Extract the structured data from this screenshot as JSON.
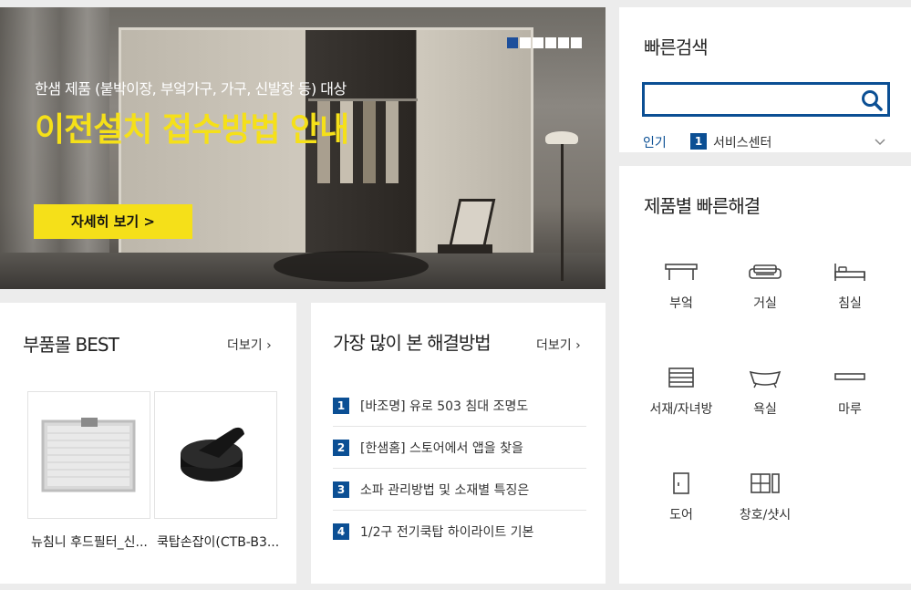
{
  "banner": {
    "subtitle": "한샘 제품 (붙박이장, 부엌가구, 가구, 신발장 등) 대상",
    "headline": "이전설치 접수방법 안내",
    "cta": "자세히 보기  >",
    "slide_count": 6,
    "active_slide": 1
  },
  "parts": {
    "title": "부품몰 BEST",
    "more": "더보기 ›",
    "products": [
      {
        "name": "뉴침니 후드필터_신..."
      },
      {
        "name": "쿡탑손잡이(CTB-B3..."
      }
    ]
  },
  "solutions": {
    "title": "가장 많이 본 해결방법",
    "more": "더보기 ›",
    "items": [
      {
        "num": "1",
        "text": "[바조명] 유로 503 침대 조명도"
      },
      {
        "num": "2",
        "text": "[한샘홈] 스토어에서 앱을 찾을"
      },
      {
        "num": "3",
        "text": "소파 관리방법 및 소재별 특징은"
      },
      {
        "num": "4",
        "text": "1/2구 전기쿡탑 하이라이트 기본"
      }
    ]
  },
  "quick_search": {
    "title": "빠른검색",
    "input_value": "",
    "popular_label": "인기",
    "popular_num": "1",
    "popular_text": "서비스센터"
  },
  "quick_resolve": {
    "title": "제품별 빠른해결",
    "categories": [
      {
        "label": "부엌",
        "icon": "kitchen-table-icon"
      },
      {
        "label": "거실",
        "icon": "sofa-icon"
      },
      {
        "label": "침실",
        "icon": "bed-icon"
      },
      {
        "label": "서재/자녀방",
        "icon": "bookshelf-icon"
      },
      {
        "label": "욕실",
        "icon": "bathtub-icon"
      },
      {
        "label": "마루",
        "icon": "floor-board-icon"
      },
      {
        "label": "도어",
        "icon": "door-icon"
      },
      {
        "label": "창호/샷시",
        "icon": "window-icon"
      }
    ]
  },
  "colors": {
    "accent": "#0b4f94",
    "banner_yellow": "#f5e019"
  }
}
